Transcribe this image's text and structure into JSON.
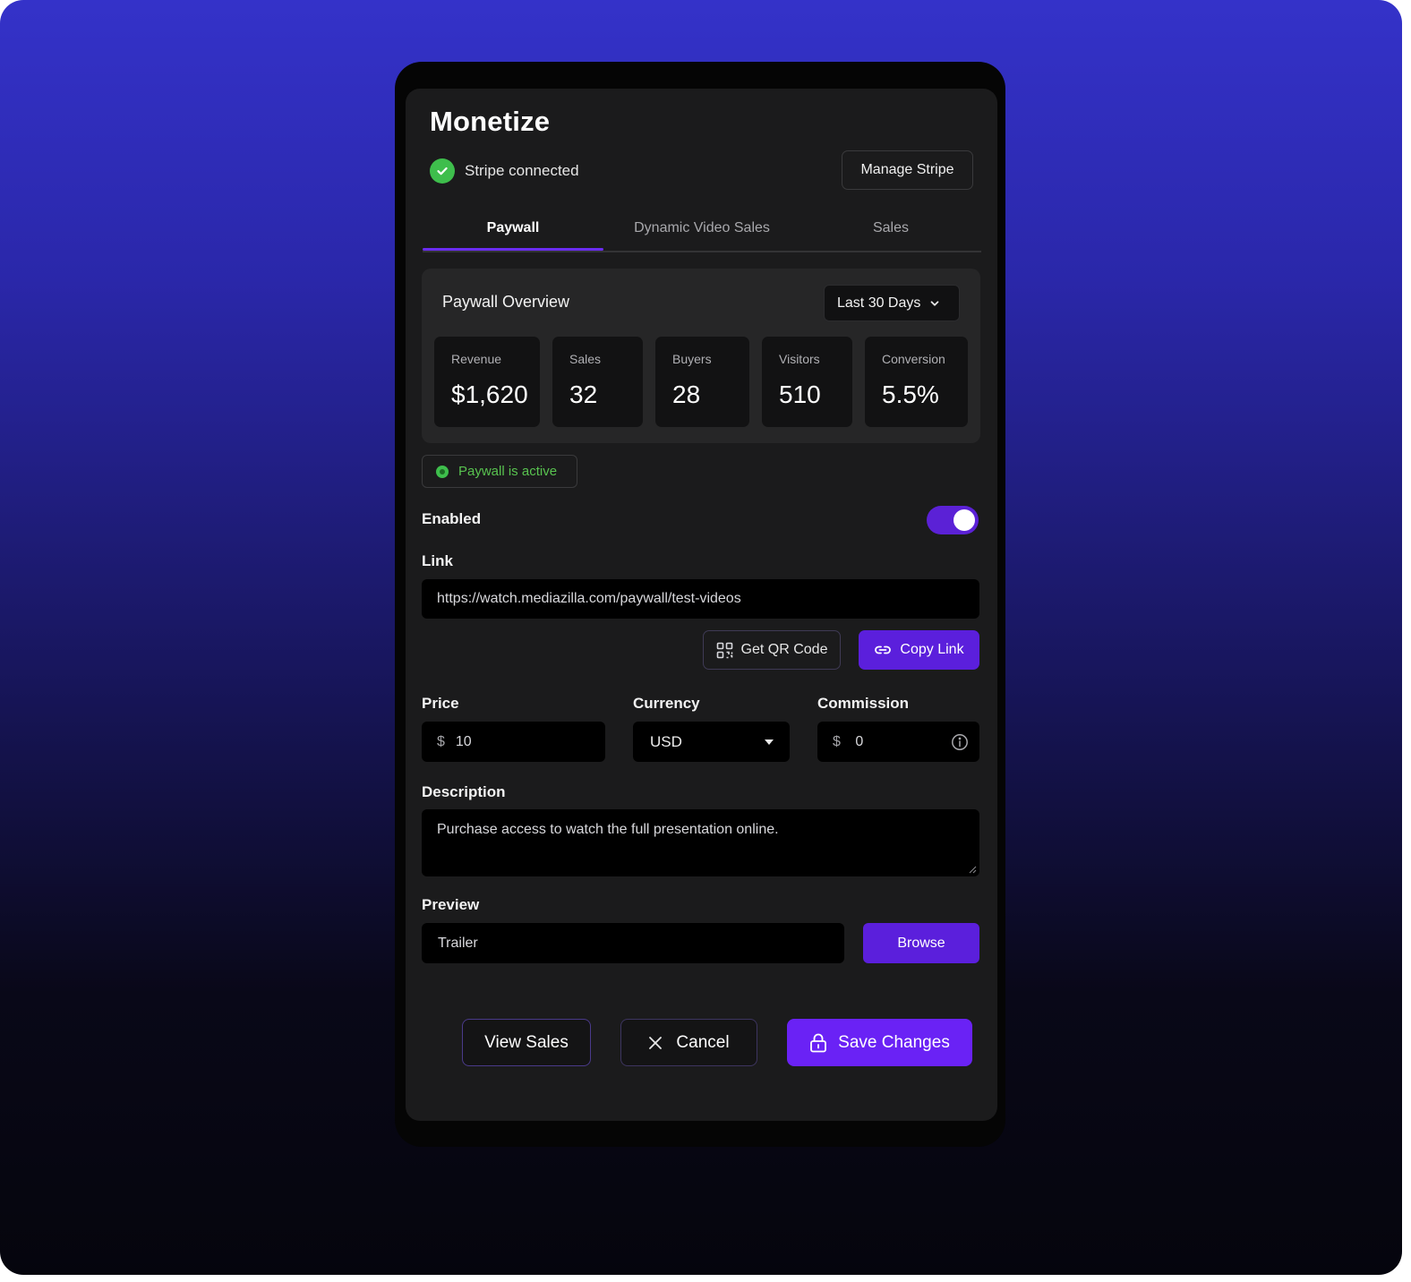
{
  "header": {
    "title": "Monetize",
    "stripe_status": "Stripe connected",
    "manage_stripe_label": "Manage Stripe"
  },
  "tabs": [
    {
      "label": "Paywall",
      "active": true
    },
    {
      "label": "Dynamic Video Sales",
      "active": false
    },
    {
      "label": "Sales",
      "active": false
    }
  ],
  "overview": {
    "title": "Paywall Overview",
    "range_selected": "Last 30 Days",
    "stats": [
      {
        "label": "Revenue",
        "value": "$1,620"
      },
      {
        "label": "Sales",
        "value": "32"
      },
      {
        "label": "Buyers",
        "value": "28"
      },
      {
        "label": "Visitors",
        "value": "510"
      },
      {
        "label": "Conversion",
        "value": "5.5%"
      }
    ]
  },
  "status": {
    "text": "Paywall is active",
    "color": "#58c24f"
  },
  "enabled": {
    "label": "Enabled",
    "on": true
  },
  "link": {
    "label": "Link",
    "value": "https://watch.mediazilla.com/paywall/test-videos",
    "qr_label": "Get QR Code",
    "copy_label": "Copy Link"
  },
  "pricing": {
    "price_label": "Price",
    "price_prefix": "$",
    "price_value": "10",
    "currency_label": "Currency",
    "currency_value": "USD",
    "commission_label": "Commission",
    "commission_prefix": "$",
    "commission_value": "0"
  },
  "description": {
    "label": "Description",
    "value": "Purchase access to watch the full presentation online."
  },
  "preview": {
    "label": "Preview",
    "value": "Trailer",
    "browse_label": "Browse"
  },
  "actions": {
    "view_sales_label": "View Sales",
    "cancel_label": "Cancel",
    "save_label": "Save Changes"
  },
  "colors": {
    "accent": "#6a22f5",
    "button_purple": "#5b1fdc",
    "success": "#3ebe4c",
    "card_bg": "#1b1b1c"
  },
  "icons": {
    "stripe_status": "check-circle-icon",
    "range": "chevron-down-icon",
    "qr": "qr-code-icon",
    "copy": "link-icon",
    "currency": "caret-down-icon",
    "commission": "info-icon",
    "cancel": "close-icon",
    "save": "lock-icon"
  }
}
